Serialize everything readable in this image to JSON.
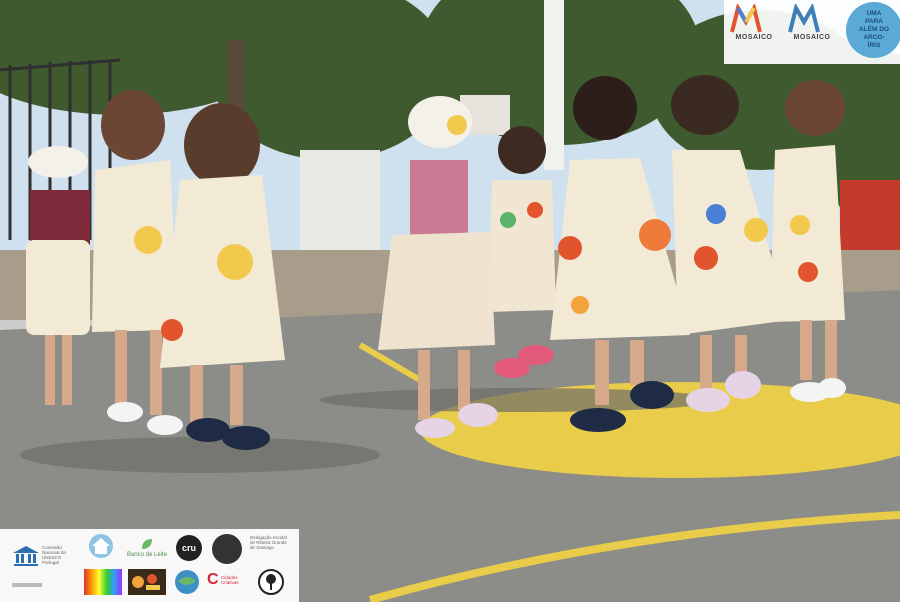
{
  "photo": {
    "subject": "children-in-painted-costumes-dancing-in-schoolyard",
    "palette": {
      "sky": "#cfe0ee",
      "trees": "#3f5a2e",
      "asphalt": "#8c8c88",
      "yellow_paint": "#e9cc4a",
      "costume": "#f3ead6",
      "sun_yellow": "#f2c94c",
      "flower_red": "#e2542c",
      "flower_blue": "#4a7fd6"
    }
  },
  "branding": {
    "mosaico_1": "MOSAICO",
    "mosaico_2": "MOSAICO",
    "badge_text": "UMA\nPARA\nALÉM DO\nARCO-\nÍRIS"
  },
  "partners": {
    "unesco_caption": "Comissão\nNacional da\nUNESCO\nPortugal",
    "banco_label": "Banco de Leite",
    "cru_label": "cru",
    "lisboa_caption": "Delegação escolar\nde Ribeira Grande\nde Santiago",
    "c_label": "C",
    "c_caption": "Cidades\nCriativas"
  }
}
